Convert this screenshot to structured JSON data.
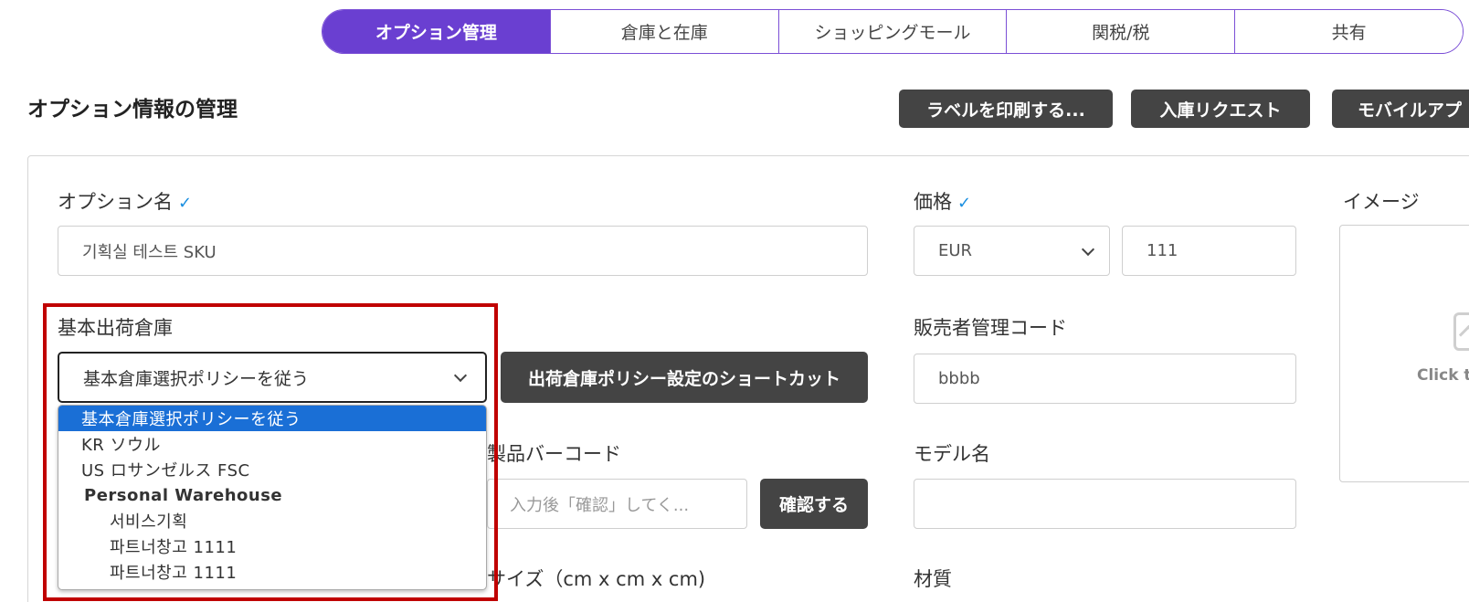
{
  "tabs": [
    {
      "label": "オプション管理",
      "active": true
    },
    {
      "label": "倉庫と在庫",
      "active": false
    },
    {
      "label": "ショッピングモール",
      "active": false
    },
    {
      "label": "関税/税",
      "active": false
    },
    {
      "label": "共有",
      "active": false
    }
  ],
  "page_title": "オプション情報の管理",
  "actions": {
    "print_label": "ラベルを印刷する...",
    "inbound_request": "入庫リクエスト",
    "mobile_app": "モバイルアプ"
  },
  "form": {
    "option_name": {
      "label": "オプション名",
      "value": "기획실 테스트 SKU"
    },
    "price": {
      "label": "価格",
      "currency": "EUR",
      "value": "111"
    },
    "image": {
      "label": "イメージ",
      "hint": "Click to"
    },
    "warehouse": {
      "label": "基本出荷倉庫",
      "selected": "基本倉庫選択ポリシーを従う",
      "shortcut_button": "出荷倉庫ポリシー設定のショートカット",
      "options": [
        {
          "label": "基本倉庫選択ポリシーを従う",
          "type": "selected"
        },
        {
          "label": "KR ソウル",
          "type": "item"
        },
        {
          "label": "US ロサンゼルス FSC",
          "type": "item"
        },
        {
          "label": "Personal Warehouse",
          "type": "group"
        },
        {
          "label": "서비스기획",
          "type": "sub"
        },
        {
          "label": "파트너창고 1111",
          "type": "sub"
        },
        {
          "label": "파트너창고 1111",
          "type": "sub"
        }
      ]
    },
    "seller_code": {
      "label": "販売者管理コード",
      "value": "bbbb"
    },
    "barcode": {
      "label": "製品バーコード",
      "placeholder": "入力後「確認」してく...",
      "confirm_button": "確認する"
    },
    "model_name": {
      "label": "モデル名",
      "value": ""
    },
    "size": {
      "label": "サイズ（cm x cm x cm)"
    },
    "material": {
      "label": "材質"
    }
  },
  "colors": {
    "accent": "#6a3fd1",
    "selected_option": "#1a6fd6",
    "highlight": "#c00000",
    "check": "#1a8fe0"
  }
}
